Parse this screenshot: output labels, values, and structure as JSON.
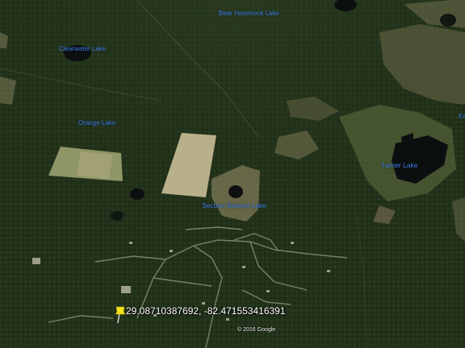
{
  "map": {
    "labels": {
      "bear_hammock": "Bear Hammock Lake",
      "clearwater": "Clearwater Lake",
      "orange": "Orange Lake",
      "turner": "Turner Lake",
      "section_sixteen": "Section Sixteen Lake",
      "edge_fragment": "Ea"
    },
    "coordinates": "29.08710387692, -82.471553416391",
    "copyright": "© 2016 Google",
    "colors": {
      "label": "#3f7fe8",
      "forest": "#223219",
      "water": "#0c0f10",
      "clearing": "#b8b08a"
    },
    "icons": {
      "marker": "pushpin-icon"
    }
  }
}
